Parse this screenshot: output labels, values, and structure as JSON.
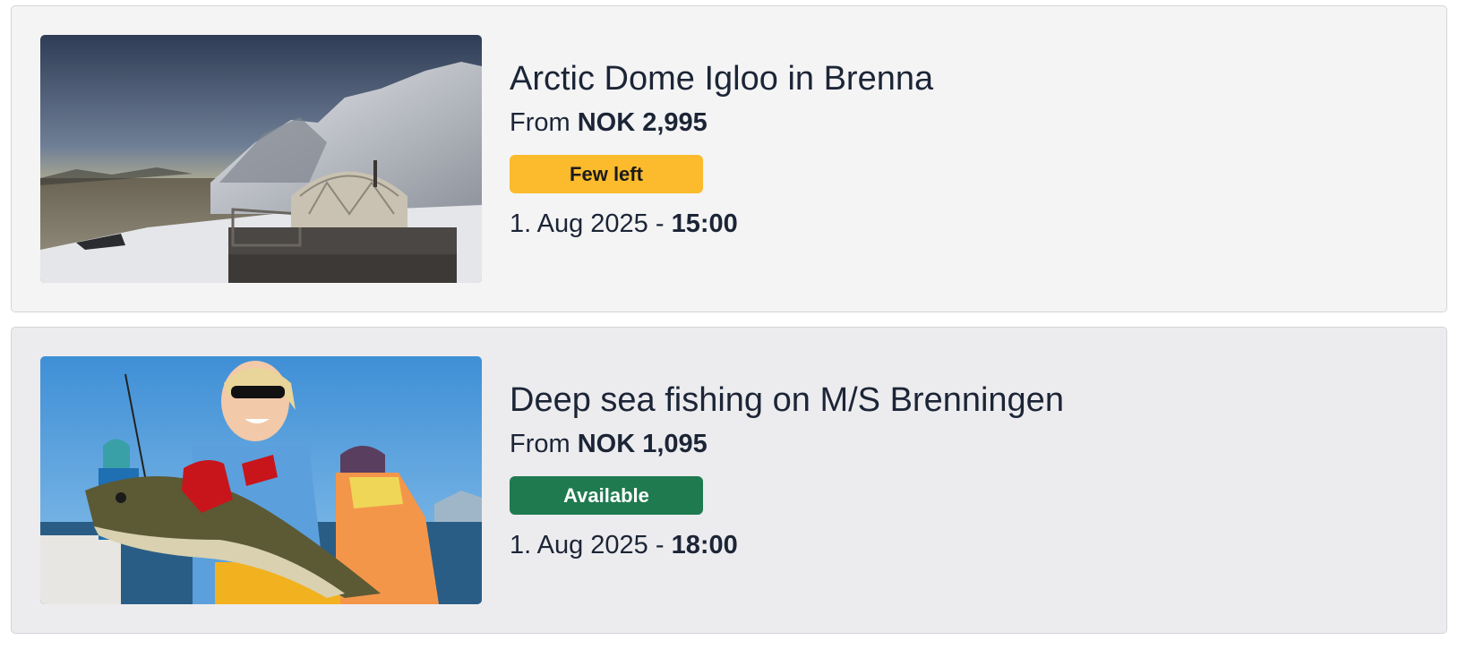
{
  "events": [
    {
      "title": "Arctic Dome Igloo in Brenna",
      "price_prefix": "From",
      "price": "NOK 2,995",
      "availability": "Few left",
      "date": "1. Aug 2025",
      "separator": " - ",
      "time": "15:00",
      "image": "arctic-dome-photo",
      "badge_color": "#fbbb2d"
    },
    {
      "title": "Deep sea fishing on M/S Brenningen",
      "price_prefix": "From",
      "price": "NOK 1,095",
      "availability": "Available",
      "date": "1. Aug 2025",
      "separator": " - ",
      "time": "18:00",
      "image": "fishing-photo",
      "badge_color": "#1f7a50"
    }
  ]
}
